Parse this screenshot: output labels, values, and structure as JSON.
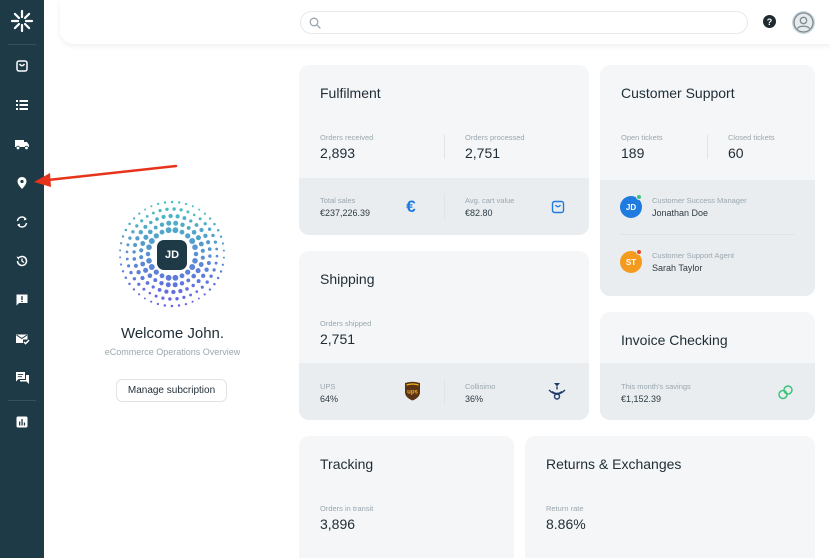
{
  "search": {
    "placeholder": ""
  },
  "header": {
    "help_label": "?"
  },
  "user": {
    "initials": "JD",
    "welcome": "Welcome John.",
    "subtitle": "eCommerce Operations Overview",
    "manage_label": "Manage subcription"
  },
  "sidebar": {
    "items": [
      "shopping-bag-icon",
      "list-icon",
      "truck-icon",
      "location-pin-icon",
      "sync-icon",
      "history-icon",
      "alert-message-icon",
      "mail-check-icon",
      "chat-icon",
      "report-chart-icon"
    ]
  },
  "fulfilment": {
    "title": "Fulfilment",
    "orders_received_label": "Orders received",
    "orders_received": "2,893",
    "orders_processed_label": "Orders processed",
    "orders_processed": "2,751",
    "total_sales_label": "Total sales",
    "total_sales": "€237,226.39",
    "avg_cart_label": "Avg. cart value",
    "avg_cart": "€82.80"
  },
  "support": {
    "title": "Customer Support",
    "open_label": "Open tickets",
    "open": "189",
    "closed_label": "Closed tickets",
    "closed": "60",
    "agents": [
      {
        "initials": "JD",
        "role": "Customer Success Manager",
        "name": "Jonathan Doe",
        "color": "#1f7be0",
        "status": "#3cc47c"
      },
      {
        "initials": "ST",
        "role": "Customer Support Agent",
        "name": "Sarah Taylor",
        "color": "#f39a1f",
        "status": "#e8452c"
      }
    ]
  },
  "shipping": {
    "title": "Shipping",
    "orders_shipped_label": "Orders shipped",
    "orders_shipped": "2,751",
    "carriers": [
      {
        "name": "UPS",
        "share": "64%"
      },
      {
        "name": "Collisimo",
        "share": "36%"
      }
    ]
  },
  "invoice": {
    "title": "Invoice Checking",
    "savings_label": "This month's savings",
    "savings": "€1,152.39"
  },
  "tracking": {
    "title": "Tracking",
    "in_transit_label": "Orders in transit",
    "in_transit": "3,896"
  },
  "returns": {
    "title": "Returns & Exchanges",
    "rate_label": "Return rate",
    "rate": "8.86%"
  },
  "annotation": {
    "arrow_color": "#e8331c"
  },
  "colors": {
    "sidebar": "#1e3a47",
    "card": "#f4f6f8",
    "card_lower": "#e9edf0",
    "accent_blue": "#1f7be0",
    "accent_green": "#3cc47c"
  }
}
